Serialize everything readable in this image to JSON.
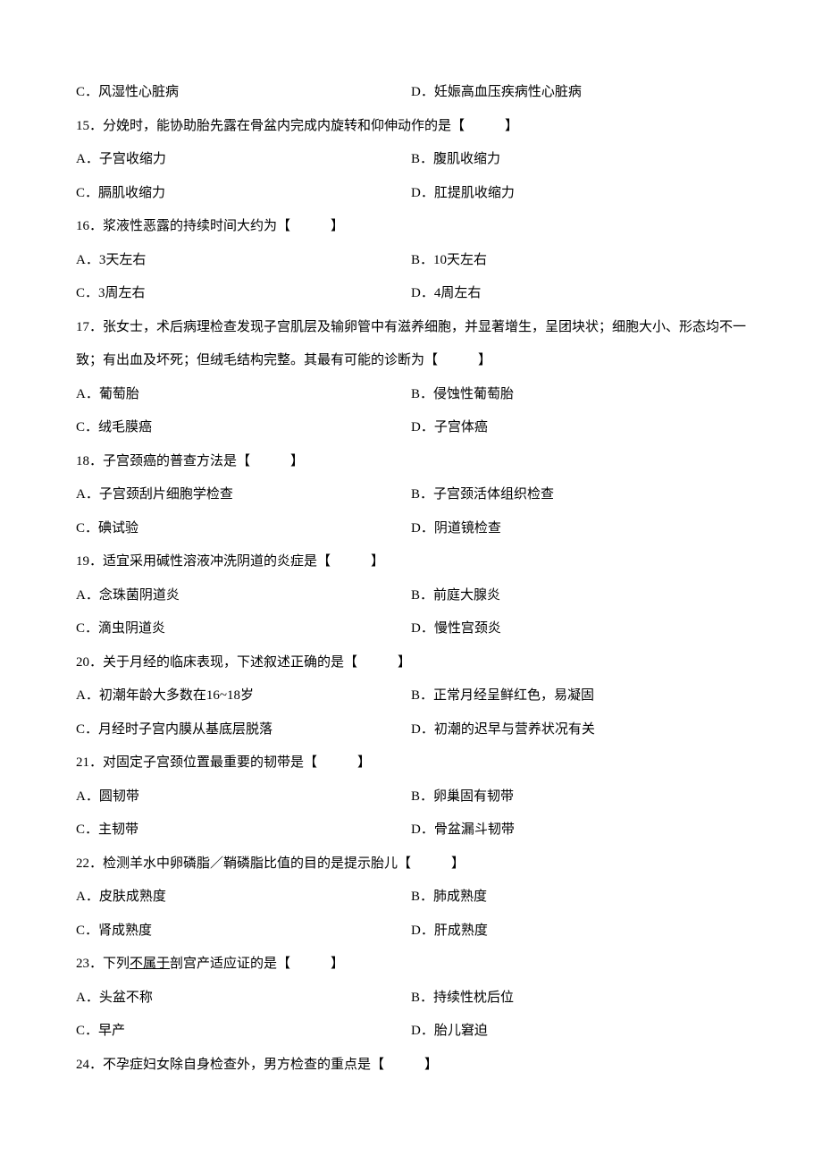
{
  "q14": {
    "c": "C．风湿性心脏病",
    "d": "D．妊娠高血压疾病性心脏病"
  },
  "q15": {
    "stem": "15．分娩时，能协助胎先露在骨盆内完成内旋转和仰伸动作的是【　　　】",
    "a": "A．子宫收缩力",
    "b": "B．腹肌收缩力",
    "c": "C．膈肌收缩力",
    "d": "D．肛提肌收缩力"
  },
  "q16": {
    "stem": "16．浆液性恶露的持续时间大约为【　　　】",
    "a": "A．3天左右",
    "b": "B．10天左右",
    "c": "C．3周左右",
    "d": "D．4周左右"
  },
  "q17": {
    "stem": "17．张女士，术后病理检查发现子宫肌层及输卵管中有滋养细胞，并显著增生，呈团块状；细胞大小、形态均不一致；有出血及坏死；但绒毛结构完整。其最有可能的诊断为【　　　】",
    "a": "A．葡萄胎",
    "b": "B．侵蚀性葡萄胎",
    "c": "C．绒毛膜癌",
    "d": "D．子宫体癌"
  },
  "q18": {
    "stem": "18．子宫颈癌的普查方法是【　　　】",
    "a": "A．子宫颈刮片细胞学检查",
    "b": "B．子宫颈活体组织检查",
    "c": "C．碘试验",
    "d": "D．阴道镜检查"
  },
  "q19": {
    "stem": "19．适宜采用碱性溶液冲洗阴道的炎症是【　　　】",
    "a": "A．念珠菌阴道炎",
    "b": "B．前庭大腺炎",
    "c": "C．滴虫阴道炎",
    "d": "D．慢性宫颈炎"
  },
  "q20": {
    "stem": "20．关于月经的临床表现，下述叙述正确的是【　　　】",
    "a": "A．初潮年龄大多数在16~18岁",
    "b": "B．正常月经呈鲜红色，易凝固",
    "c": "C．月经时子宫内膜从基底层脱落",
    "d": "D．初潮的迟早与营养状况有关"
  },
  "q21": {
    "stem": "21．对固定子宫颈位置最重要的韧带是【　　　】",
    "a": "A．圆韧带",
    "b": "B．卵巢固有韧带",
    "c": "C．主韧带",
    "d": "D．骨盆漏斗韧带"
  },
  "q22": {
    "stem": "22．检测羊水中卵磷脂／鞘磷脂比值的目的是提示胎儿【　　　】",
    "a": "A．皮肤成熟度",
    "b": "B．肺成熟度",
    "c": "C．肾成熟度",
    "d": "D．肝成熟度"
  },
  "q23": {
    "stem_prefix": "23．下列",
    "stem_underlined": "不属于",
    "stem_suffix": "剖宫产适应证的是【　　　】",
    "a": "A．头盆不称",
    "b": "B．持续性枕后位",
    "c": "C．早产",
    "d": "D．胎儿窘迫"
  },
  "q24": {
    "stem": "24．不孕症妇女除自身检查外，男方检查的重点是【　　　】"
  }
}
